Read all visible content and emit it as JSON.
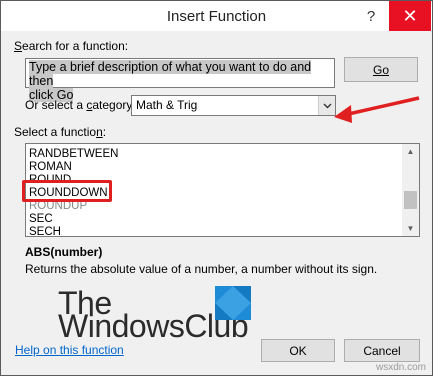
{
  "window": {
    "title": "Insert Function",
    "help_button": "?",
    "close_button": "✕"
  },
  "search": {
    "label_prefix": "",
    "label_underline": "S",
    "label_rest": "earch for a function:",
    "text_line1": "Type a brief description of what you want to do and then",
    "text_line2": "click Go",
    "go_button_label": "Go"
  },
  "category": {
    "label_prefix": "Or select a ",
    "label_underline": "c",
    "label_rest": "ategory:",
    "selected": "Math & Trig",
    "arrow_icon": "chevron-down-icon"
  },
  "function_list": {
    "label_prefix": "Select a functio",
    "label_underline": "n",
    "label_rest": ":",
    "items": [
      "RANDBETWEEN",
      "ROMAN",
      "ROUND",
      "ROUNDDOWN",
      "ROUNDUP",
      "SEC",
      "SECH"
    ],
    "highlighted": "ROUNDDOWN"
  },
  "details": {
    "signature": "ABS(number)",
    "description": "Returns the absolute value of a number, a number without its sign."
  },
  "footer": {
    "help_link": "Help on this function",
    "ok_label": "OK",
    "cancel_label": "Cancel"
  },
  "logo": {
    "line1": "The",
    "line2": "WindowsClub",
    "icon": "windows-logo-icon"
  },
  "watermark": "wsxdn.com",
  "colors": {
    "annotation_red": "#e02020",
    "link_blue": "#0066cc",
    "close_red": "#e81123"
  }
}
